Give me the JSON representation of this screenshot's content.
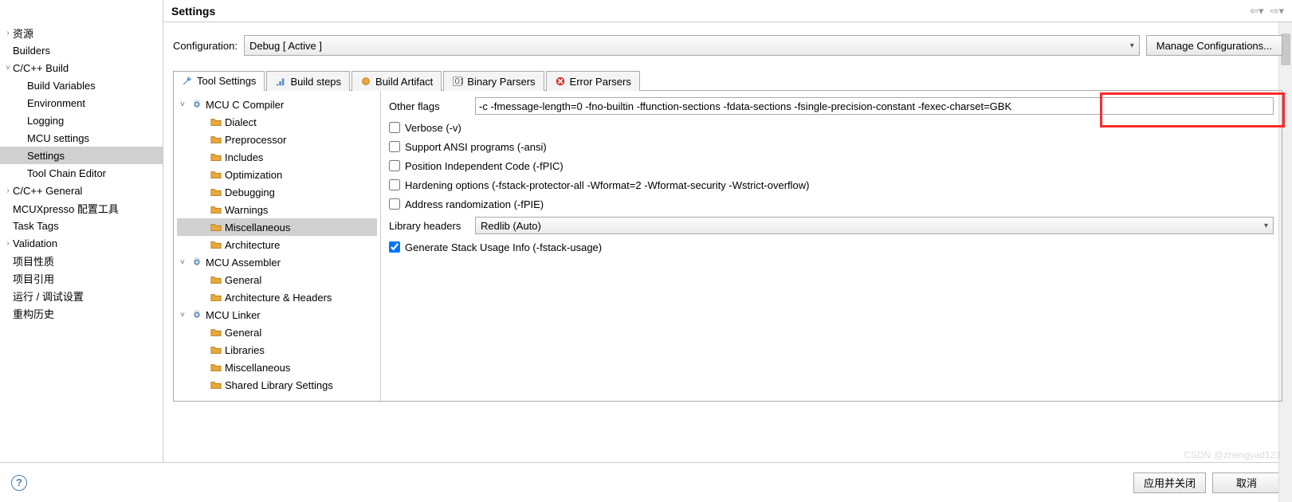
{
  "header": {
    "title": "Settings"
  },
  "left_tree": {
    "items": [
      {
        "label": "资源",
        "level": 0,
        "arrow": ">"
      },
      {
        "label": "Builders",
        "level": 0,
        "arrow": ""
      },
      {
        "label": "C/C++ Build",
        "level": 0,
        "arrow": "v"
      },
      {
        "label": "Build Variables",
        "level": 1,
        "arrow": ""
      },
      {
        "label": "Environment",
        "level": 1,
        "arrow": ""
      },
      {
        "label": "Logging",
        "level": 1,
        "arrow": ""
      },
      {
        "label": "MCU settings",
        "level": 1,
        "arrow": ""
      },
      {
        "label": "Settings",
        "level": 1,
        "arrow": "",
        "selected": true
      },
      {
        "label": "Tool Chain Editor",
        "level": 1,
        "arrow": ""
      },
      {
        "label": "C/C++ General",
        "level": 0,
        "arrow": ">"
      },
      {
        "label": "MCUXpresso 配置工具",
        "level": 0,
        "arrow": ""
      },
      {
        "label": "Task Tags",
        "level": 0,
        "arrow": ""
      },
      {
        "label": "Validation",
        "level": 0,
        "arrow": ">"
      },
      {
        "label": "项目性质",
        "level": 0,
        "arrow": ""
      },
      {
        "label": "项目引用",
        "level": 0,
        "arrow": ""
      },
      {
        "label": "运行 / 调试设置",
        "level": 0,
        "arrow": ""
      },
      {
        "label": "重构历史",
        "level": 0,
        "arrow": ""
      }
    ]
  },
  "config": {
    "label": "Configuration:",
    "value": "Debug  [ Active ]",
    "manage_btn": "Manage Configurations..."
  },
  "tabs": [
    {
      "label": "Tool Settings",
      "icon": "wrench",
      "active": true
    },
    {
      "label": "Build steps",
      "icon": "steps"
    },
    {
      "label": "Build Artifact",
      "icon": "artifact"
    },
    {
      "label": "Binary Parsers",
      "icon": "binary"
    },
    {
      "label": "Error Parsers",
      "icon": "error"
    }
  ],
  "tool_tree": [
    {
      "label": "MCU C Compiler",
      "level": 0,
      "arrow": "v",
      "icon": "gear"
    },
    {
      "label": "Dialect",
      "level": 1,
      "icon": "folder"
    },
    {
      "label": "Preprocessor",
      "level": 1,
      "icon": "folder"
    },
    {
      "label": "Includes",
      "level": 1,
      "icon": "folder"
    },
    {
      "label": "Optimization",
      "level": 1,
      "icon": "folder"
    },
    {
      "label": "Debugging",
      "level": 1,
      "icon": "folder"
    },
    {
      "label": "Warnings",
      "level": 1,
      "icon": "folder"
    },
    {
      "label": "Miscellaneous",
      "level": 1,
      "icon": "folder",
      "selected": true
    },
    {
      "label": "Architecture",
      "level": 1,
      "icon": "folder"
    },
    {
      "label": "MCU Assembler",
      "level": 0,
      "arrow": "v",
      "icon": "gear"
    },
    {
      "label": "General",
      "level": 1,
      "icon": "folder"
    },
    {
      "label": "Architecture & Headers",
      "level": 1,
      "icon": "folder"
    },
    {
      "label": "MCU Linker",
      "level": 0,
      "arrow": "v",
      "icon": "gear"
    },
    {
      "label": "General",
      "level": 1,
      "icon": "folder"
    },
    {
      "label": "Libraries",
      "level": 1,
      "icon": "folder"
    },
    {
      "label": "Miscellaneous",
      "level": 1,
      "icon": "folder"
    },
    {
      "label": "Shared Library Settings",
      "level": 1,
      "icon": "folder"
    }
  ],
  "settings": {
    "other_flags_label": "Other flags",
    "other_flags_value": "-c -fmessage-length=0 -fno-builtin -ffunction-sections -fdata-sections -fsingle-precision-constant -fexec-charset=GBK",
    "checkboxes": [
      {
        "label": "Verbose (-v)",
        "checked": false
      },
      {
        "label": "Support ANSI programs (-ansi)",
        "checked": false
      },
      {
        "label": "Position Independent Code (-fPIC)",
        "checked": false
      },
      {
        "label": "Hardening options (-fstack-protector-all -Wformat=2 -Wformat-security -Wstrict-overflow)",
        "checked": false
      },
      {
        "label": "Address randomization (-fPIE)",
        "checked": false
      }
    ],
    "library_headers_label": "Library headers",
    "library_headers_value": "Redlib (Auto)",
    "generate_stack_label": "Generate Stack Usage Info (-fstack-usage)",
    "generate_stack_checked": true
  },
  "footer": {
    "apply_close": "应用并关闭",
    "cancel": "取消"
  },
  "watermark": "CSDN @zhengyad123"
}
